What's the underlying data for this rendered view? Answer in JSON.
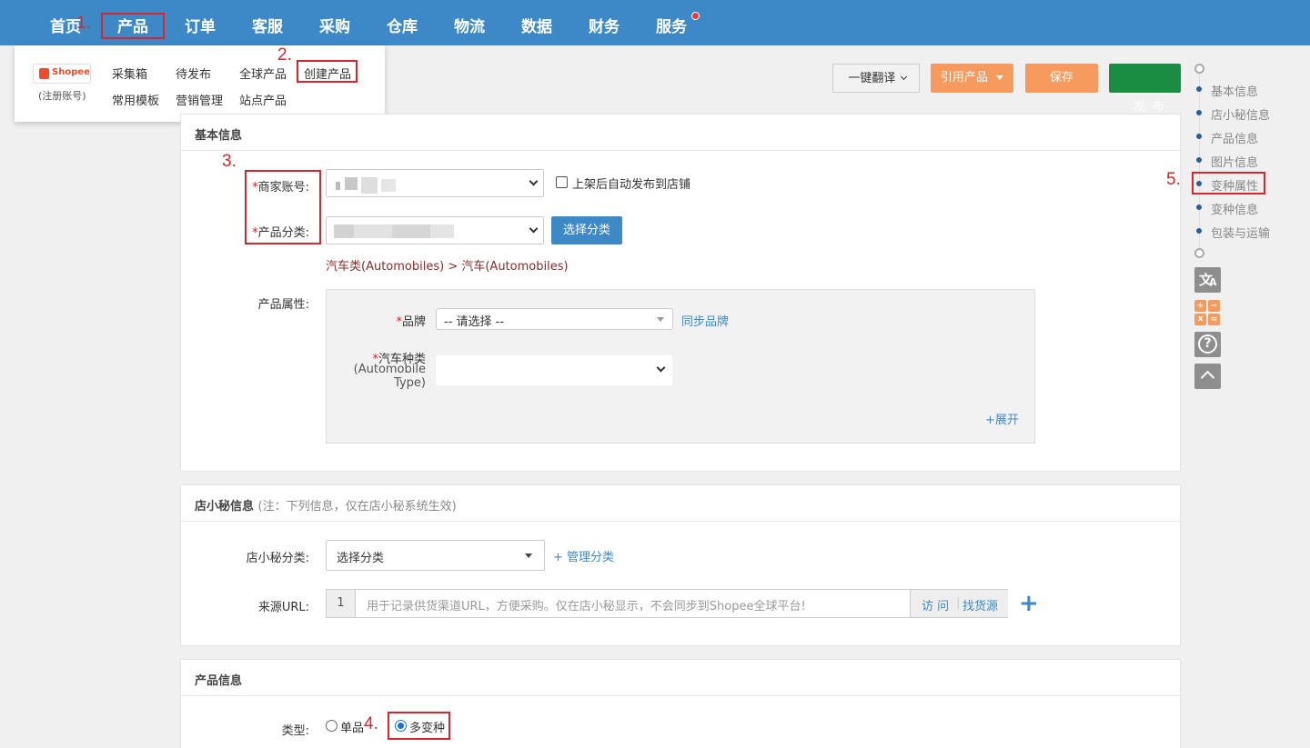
{
  "nav": {
    "items": [
      "首页",
      "产品",
      "订单",
      "客服",
      "采购",
      "仓库",
      "物流",
      "数据",
      "财务",
      "服务"
    ]
  },
  "annotations": {
    "n1": "1.",
    "n2": "2.",
    "n3": "3.",
    "n4": "4.",
    "n5": "5."
  },
  "dropdown": {
    "logo_text": "Shopee",
    "logo_sub": "(注册账号)",
    "items": [
      "采集箱",
      "待发布",
      "全球产品",
      "创建产品",
      "常用模板",
      "营销管理",
      "站点产品"
    ]
  },
  "toolbar": {
    "translate": "一键翻译",
    "cite": "引用产品",
    "save": "保存",
    "publish": "发  布"
  },
  "basic": {
    "title": "基本信息",
    "merchant_label": "商家账号:",
    "category_label": "产品分类:",
    "auto_publish": "上架后自动发布到店铺",
    "choose_category": "选择分类",
    "category_path": "汽车类(Automobiles) > 汽车(Automobiles)",
    "attr_label": "产品属性:",
    "brand_label": "品牌",
    "brand_placeholder": "-- 请选择 --",
    "sync_brand": "同步品牌",
    "car_type_label_1": "汽车种类",
    "car_type_label_2": "(Automobile",
    "car_type_label_3": "Type)",
    "expand": "+展开",
    "required_mark": "*"
  },
  "dxm": {
    "title": "店小秘信息",
    "note": "(注：下列信息，仅在店小秘系统生效)",
    "cat_label": "店小秘分类:",
    "cat_value": "选择分类",
    "manage": "+ 管理分类",
    "url_label": "来源URL:",
    "url_index": "1",
    "url_placeholder": "用于记录供货渠道URL，方便采购。仅在店小秘显示，不会同步到Shopee全球平台!",
    "visit": "访 问",
    "find_source": "找货源",
    "add": "+"
  },
  "product": {
    "title": "产品信息",
    "type_label": "类型:",
    "single": "单品",
    "multi": "多变种"
  },
  "sidebar": {
    "items": [
      "基本信息",
      "店小秘信息",
      "产品信息",
      "图片信息",
      "变种属性",
      "变种信息",
      "包装与运输"
    ]
  },
  "colors": {
    "nav_bg": "#3d89c7",
    "accent_orange": "#f79a5d",
    "publish_green": "#1a8d43",
    "annotation_red": "#d9262c"
  }
}
